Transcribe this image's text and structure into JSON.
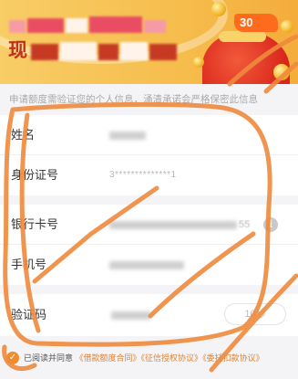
{
  "banner": {
    "headline_visible_char": "现",
    "badge": "30"
  },
  "notice": "申请额度需验证您的个人信息，涌清承诺会严格保密此信息",
  "form": {
    "name": {
      "label": "姓名"
    },
    "id_number": {
      "label": "身份证号",
      "value": "3**************1"
    },
    "bank_card": {
      "label": "银行卡号",
      "value_tail": "55",
      "info_icon": "i"
    },
    "phone": {
      "label": "手机号"
    },
    "sms_code": {
      "label": "验证码",
      "countdown": "10秒"
    }
  },
  "agreement": {
    "checked": true,
    "prefix": "已阅读并同意",
    "links": [
      "《借款额度合同》",
      "《征信授权协议》",
      "《委托扣款协议》"
    ]
  },
  "colors": {
    "banner": "#f6bd4d",
    "accent": "#f08c2e",
    "link": "#e0843a",
    "annotation": "#ef8a3d"
  },
  "icons": {
    "checkbox": "check-icon",
    "info": "info-icon",
    "illustration": "money-bag-icon"
  }
}
